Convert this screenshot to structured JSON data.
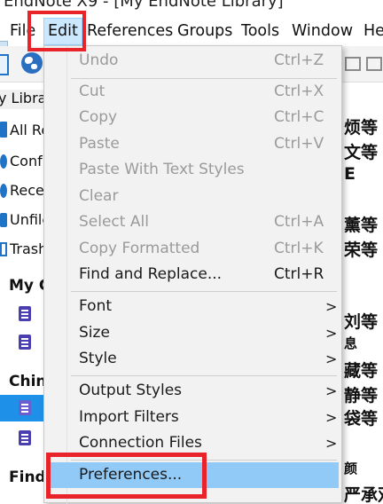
{
  "window": {
    "title": "EndNote X9 - [My EndNote Library]"
  },
  "menubar": {
    "items": [
      "File",
      "Edit",
      "References",
      "Groups",
      "Tools",
      "Window",
      "He"
    ]
  },
  "left_pane": {
    "header": "y Libra",
    "items": [
      "All Re",
      "Conf",
      "Rece",
      "Unfile",
      "Trash"
    ],
    "group_headers": [
      "My G",
      "Chin",
      "Find"
    ]
  },
  "right_pane": {
    "lines": [
      "烦等",
      "文等",
      "E",
      "薰等",
      "荣等",
      "刘等",
      "息",
      "藏等",
      "静等",
      "袋等",
      "颜",
      "严承双"
    ]
  },
  "edit_menu": {
    "items": [
      {
        "label": "Undo",
        "shortcut": "Ctrl+Z",
        "state": "disabled"
      },
      {
        "label": "Cut",
        "shortcut": "Ctrl+X",
        "state": "disabled"
      },
      {
        "label": "Copy",
        "shortcut": "Ctrl+C",
        "state": "disabled"
      },
      {
        "label": "Paste",
        "shortcut": "Ctrl+V",
        "state": "disabled"
      },
      {
        "label": "Paste With Text Styles",
        "shortcut": "",
        "state": "disabled"
      },
      {
        "label": "Clear",
        "shortcut": "",
        "state": "disabled"
      },
      {
        "label": "Select All",
        "shortcut": "Ctrl+A",
        "state": "disabled"
      },
      {
        "label": "Copy Formatted",
        "shortcut": "Ctrl+K",
        "state": "disabled"
      },
      {
        "label": "Find and Replace...",
        "shortcut": "Ctrl+R",
        "state": "enabled"
      },
      {
        "label": "Font",
        "shortcut": "",
        "submenu": ">",
        "state": "enabled"
      },
      {
        "label": "Size",
        "shortcut": "",
        "submenu": ">",
        "state": "enabled"
      },
      {
        "label": "Style",
        "shortcut": "",
        "submenu": ">",
        "state": "enabled"
      },
      {
        "label": "Output Styles",
        "shortcut": "",
        "submenu": ">",
        "state": "enabled"
      },
      {
        "label": "Import Filters",
        "shortcut": "",
        "submenu": ">",
        "state": "enabled"
      },
      {
        "label": "Connection Files",
        "shortcut": "",
        "submenu": ">",
        "state": "enabled"
      },
      {
        "label": "Preferences...",
        "shortcut": "",
        "state": "highlighted"
      }
    ]
  },
  "colors": {
    "highlight_box": "#e8232a",
    "menu_hover": "#91c9f7",
    "selection": "#1e90e8",
    "group_icon": "#4a3fb0"
  }
}
